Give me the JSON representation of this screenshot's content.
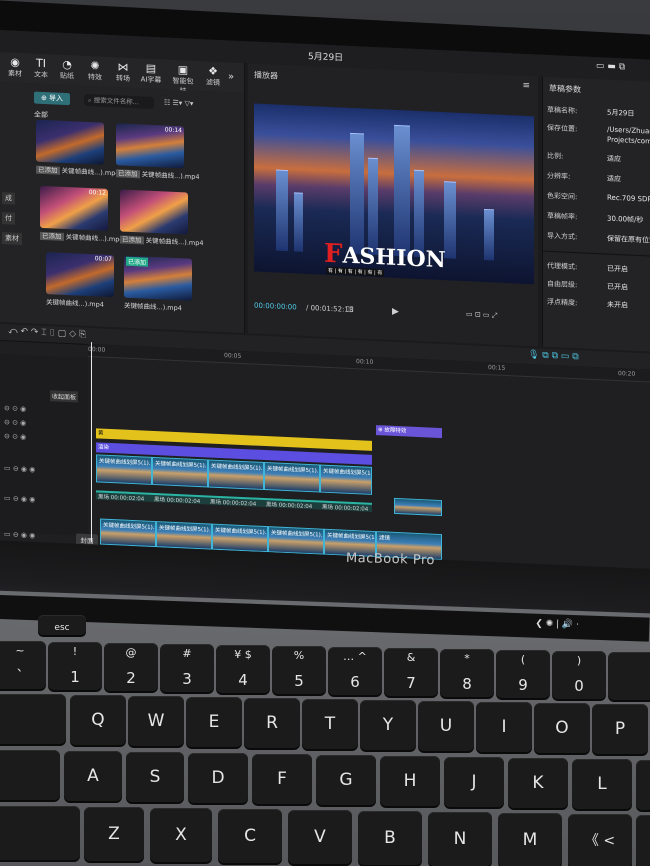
{
  "screen": {
    "menubar": {
      "date": "5月29日"
    },
    "toolbar": {
      "items": [
        {
          "label": "素材",
          "icon": "grid-icon"
        },
        {
          "label": "文本",
          "icon": "text-icon"
        },
        {
          "label": "贴纸",
          "icon": "sticker-icon"
        },
        {
          "label": "特效",
          "icon": "effects-icon"
        },
        {
          "label": "转场",
          "icon": "transition-icon"
        },
        {
          "label": "AI字幕",
          "icon": "ai-icon"
        },
        {
          "label": "智能包装",
          "icon": "package-icon"
        },
        {
          "label": "滤镜",
          "icon": "filter-icon"
        }
      ]
    },
    "media": {
      "import_label": "导入",
      "search_placeholder": "搜索文件名称...",
      "all_label": "全部",
      "side_labels": [
        "成",
        "付",
        "素材"
      ],
      "clips": [
        {
          "label": "关键帧曲线...).mp4",
          "duration": "",
          "badge": "已添加"
        },
        {
          "label": "关键帧曲线...).mp4",
          "duration": "00:14",
          "badge": "已添加"
        },
        {
          "label": "关键帧曲线...).mp4",
          "duration": "00:12",
          "badge": "已添加"
        },
        {
          "label": "关键帧曲线...).mp4",
          "duration": "",
          "badge": "已添加"
        },
        {
          "label": "关键帧曲线...).mp4",
          "duration": "00:07",
          "badge": ""
        },
        {
          "label": "关键帧曲线...).mp4",
          "duration": "",
          "badge": "已添加"
        }
      ]
    },
    "preview": {
      "title": "播放器",
      "overlay_text_first": "F",
      "overlay_text_rest": "ASHION",
      "subtitle_chars": "有 | 有 | 有 | 有 | 有 | 有",
      "current_time": "00:00:00:00",
      "total_time": "00:01:52:13"
    },
    "properties": {
      "title": "草稿参数",
      "rows": [
        {
          "label": "草稿名称:",
          "value": "5月29日"
        },
        {
          "label": "保存位置:",
          "value": "/Users/Zhuang..."
        },
        {
          "label": "",
          "value": "Projects/com..."
        },
        {
          "label": "比例:",
          "value": "适应"
        },
        {
          "label": "分辨率:",
          "value": "适应"
        },
        {
          "label": "色彩空间:",
          "value": "Rec.709 SDR"
        },
        {
          "label": "草稿帧率:",
          "value": "30.00帧/秒"
        },
        {
          "label": "导入方式:",
          "value": "保留在原有位置"
        },
        {
          "label": "代理模式:",
          "value": "已开启"
        },
        {
          "label": "自由层级:",
          "value": "已开启"
        },
        {
          "label": "浮点精度:",
          "value": "未开启"
        }
      ]
    },
    "timeline": {
      "ruler_marks": [
        "00:00",
        "00:05",
        "00:10",
        "00:15",
        "00:20"
      ],
      "cover_label": "封面",
      "tooltip_label": "收起面板",
      "effect_clips": [
        "黄",
        "渲染",
        "旧影",
        "故障特效"
      ],
      "video_clip_label": "关键帧曲线划屏5(1)...",
      "audio_clip_label": "黑场  00:00:02:04",
      "main_clip_label": "关键帧曲线划屏5(1)...",
      "transition_label": "滤镜"
    }
  },
  "laptop": {
    "brand": "MacBook Pro",
    "number_row": [
      {
        "sym": "~",
        "dig": "`"
      },
      {
        "sym": "!",
        "dig": "1"
      },
      {
        "sym": "@",
        "dig": "2"
      },
      {
        "sym": "#",
        "dig": "3"
      },
      {
        "sym": "¥ $",
        "dig": "4"
      },
      {
        "sym": "%",
        "dig": "5"
      },
      {
        "sym": "… ^",
        "dig": "6"
      },
      {
        "sym": "&",
        "dig": "7"
      },
      {
        "sym": "*",
        "dig": "8"
      },
      {
        "sym": "(",
        "dig": "9"
      },
      {
        "sym": ")",
        "dig": "0"
      }
    ],
    "row_q": [
      "Q",
      "W",
      "E",
      "R",
      "T",
      "Y",
      "U",
      "I",
      "O",
      "P"
    ],
    "row_a": [
      "A",
      "S",
      "D",
      "F",
      "G",
      "H",
      "J",
      "K",
      "L"
    ],
    "row_z": [
      "Z",
      "X",
      "C",
      "V",
      "B",
      "N",
      "M",
      "《 <"
    ],
    "esc": "esc"
  }
}
